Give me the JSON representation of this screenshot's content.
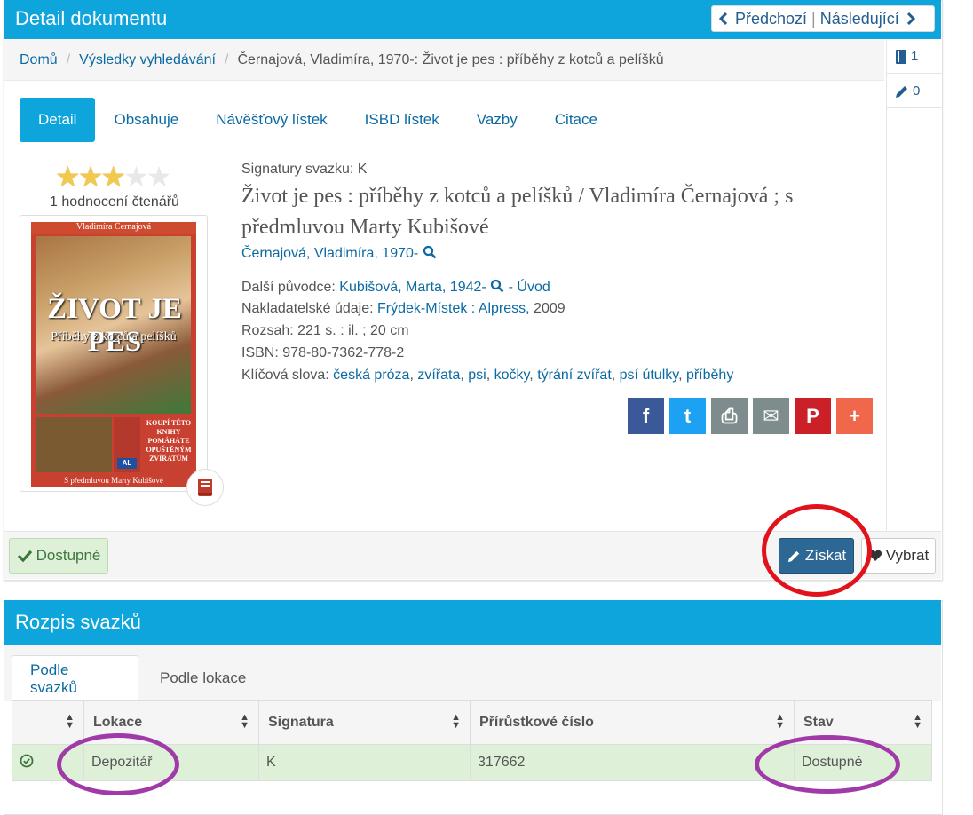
{
  "header": {
    "title": "Detail dokumentu",
    "prev_label": "Předchozí",
    "sep": "|",
    "next_label": "Následující"
  },
  "breadcrumb": {
    "items": [
      "Domů",
      "Výsledky vyhledávání"
    ],
    "current": "Černajová, Vladimíra, 1970-: Život je pes : příběhy z kotců a pelíšků",
    "separator": "/"
  },
  "sidebar": {
    "items": [
      {
        "icon": "book-icon",
        "count": "1"
      },
      {
        "icon": "pencil-icon",
        "count": "0"
      }
    ]
  },
  "tabs": [
    "Detail",
    "Obsahuje",
    "Návěšťový lístek",
    "ISBD lístek",
    "Vazby",
    "Citace"
  ],
  "rating": {
    "stars_filled": 3,
    "stars_total": 5,
    "count_text": "1 hodnocení čtenářů"
  },
  "cover": {
    "author": "Vladimíra Černajová",
    "title": "ŽIVOT JE PES",
    "subtitle": "Příběhy z kotců a pelíšků",
    "promo": "KOUPÍ TÉTO KNIHY POMÁHÁTE OPUŠTĚNÝM ZVÍŘATŮM",
    "publisher_mark": "AL",
    "foot": "S předmluvou Marty Kubišové"
  },
  "record": {
    "signatures_label": "Signatury svazku:",
    "signatures_value": "K",
    "title_line1": "Život je pes : příběhy z kotců a pelíšků / Vladimíra Černajová ; s",
    "title_line2": "předmluvou Marty Kubišové",
    "author": "Černajová, Vladimíra, 1970-",
    "other_label": "Další původce:",
    "other_value": "Kubišová, Marta, 1942-",
    "other_dash": "-",
    "other_role": "Úvod",
    "publisher_label": "Nakladatelské údaje:",
    "publisher_place": "Frýdek-Místek : Alpress,",
    "publisher_year": "2009",
    "extent_label": "Rozsah:",
    "extent_value": "221 s. : il. ; 20 cm",
    "isbn_label": "ISBN:",
    "isbn_value": "978-80-7362-778-2",
    "keywords_label": "Klíčová slova:",
    "keywords": [
      "česká próza",
      "zvířata",
      "psi",
      "kočky",
      "týrání zvířat",
      "psí útulky",
      "příběhy"
    ]
  },
  "share": {
    "icons": [
      "facebook-icon",
      "twitter-icon",
      "print-icon",
      "email-icon",
      "pinterest-icon",
      "more-icon"
    ],
    "colors": [
      "#3b5998",
      "#1da1f2",
      "#7f8c8d",
      "#7f8c8d",
      "#cb2027",
      "#f1674b"
    ],
    "glyphs": [
      "f",
      "t",
      "⎙",
      "✉",
      "P",
      "+"
    ]
  },
  "actions": {
    "available_label": "Dostupné",
    "get_label": "Získat",
    "pick_label": "Vybrat"
  },
  "holdings": {
    "title": "Rozpis svazků",
    "tabs": [
      "Podle svazků",
      "Podle lokace"
    ],
    "columns": [
      "",
      "Lokace",
      "Signatura",
      "Přírůstkové číslo",
      "Stav"
    ],
    "rows": [
      {
        "location": "Depozitář",
        "signature": "K",
        "accession": "317662",
        "status": "Dostupné"
      }
    ]
  },
  "colors": {
    "accent": "#0ea5dc",
    "link": "#0b6aa2",
    "available_bg": "#dff0d8",
    "annotation_red": "#e1121b",
    "annotation_purple": "#a03aa8"
  }
}
